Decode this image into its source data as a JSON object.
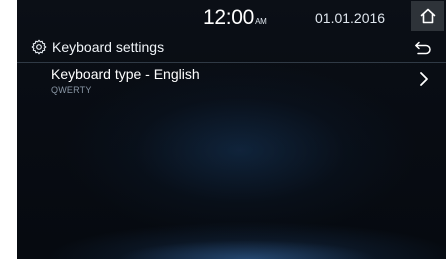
{
  "statusbar": {
    "time": "12:00",
    "ampm": "AM",
    "date": "01.01.2016",
    "home_icon": "home-icon"
  },
  "header": {
    "title": "Keyboard settings",
    "settings_icon": "gear-icon",
    "back_icon": "back-icon"
  },
  "list": {
    "items": [
      {
        "label": "Keyboard type - English",
        "value": "QWERTY",
        "icon": "chevron-right-icon"
      }
    ]
  },
  "colors": {
    "background": "#080c13",
    "text": "#ffffff",
    "subtext": "#8a97a6",
    "home_button_bg": "#2e3339"
  }
}
